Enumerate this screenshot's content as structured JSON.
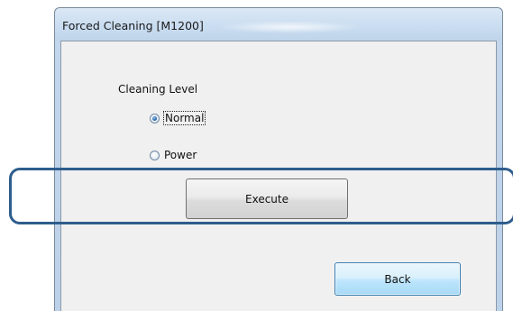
{
  "window": {
    "title": "Forced Cleaning [M1200]"
  },
  "cleaning": {
    "group_label": "Cleaning Level",
    "options": [
      {
        "label": "Normal",
        "checked": true
      },
      {
        "label": "Power",
        "checked": false
      }
    ]
  },
  "buttons": {
    "execute_label": "Execute",
    "back_label": "Back"
  },
  "colors": {
    "callout_border": "#2e5d8c",
    "window_frame": "#c2d6ec",
    "client_background": "#f0f0f0",
    "default_button": "#bee6fd"
  }
}
